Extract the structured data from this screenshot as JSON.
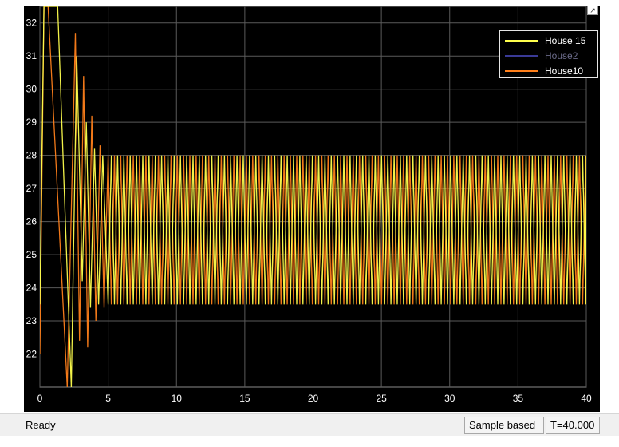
{
  "status_bar": {
    "status": "Ready",
    "sample_mode": "Sample based",
    "time": "T=40.000"
  },
  "plot": {
    "undock_glyph": "↗",
    "legend": [
      {
        "label": "House 15",
        "color": "#ffff4d"
      },
      {
        "label": "House2",
        "color": "#3a3a96"
      },
      {
        "label": "House10",
        "color": "#ff7f1a"
      }
    ],
    "colors": {
      "background": "#000000",
      "grid": "#5a5a5a",
      "house15": "#ffff4d",
      "house2": "#3a3a96",
      "house10": "#ff7f1a"
    },
    "grid": true
  },
  "chart_data": {
    "type": "line",
    "x_ticks": [
      "0",
      "5",
      "10",
      "15",
      "20",
      "25",
      "30",
      "35",
      "40"
    ],
    "y_ticks": [
      "22",
      "23",
      "24",
      "25",
      "26",
      "27",
      "28",
      "29",
      "30",
      "31",
      "32"
    ],
    "xlim": [
      0,
      40
    ],
    "ylim": [
      21,
      32.5
    ],
    "legend_position": "top-right",
    "series": [
      {
        "name": "House 15",
        "color": "#ffff4d",
        "x": [
          0,
          0.3,
          0.6,
          1.3,
          2.3,
          2.7,
          3.1,
          3.4,
          3.7,
          4.0,
          4.3,
          4.6,
          5,
          40
        ],
        "y": [
          23.5,
          32.5,
          32.5,
          32.5,
          21,
          31.0,
          24.2,
          29.0,
          23.4,
          28.2,
          23.5,
          28.0,
          23.5,
          28.0
        ],
        "note_envelope": [
          23.5,
          28.0
        ]
      },
      {
        "name": "House2",
        "color": "#3a3a96",
        "x": [
          0,
          40
        ],
        "y": [
          26,
          26
        ]
      },
      {
        "name": "House10",
        "color": "#ff7f1a",
        "x": [
          0,
          0.3,
          0.6,
          2.0,
          2.6,
          2.9,
          3.2,
          3.5,
          3.8,
          4.1,
          4.4,
          4.7,
          5,
          40
        ],
        "y": [
          22,
          32.5,
          32.5,
          21,
          31.7,
          22.4,
          30.4,
          22.2,
          29.2,
          23.0,
          28.3,
          23.4,
          28.0,
          23.5
        ]
      }
    ]
  }
}
